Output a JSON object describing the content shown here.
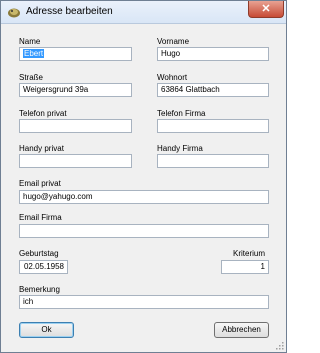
{
  "window": {
    "title": "Adresse bearbeiten",
    "close_symbol": "✕"
  },
  "form": {
    "name": {
      "label": "Name",
      "value": "Ebert"
    },
    "vorname": {
      "label": "Vorname",
      "value": "Hugo"
    },
    "strasse": {
      "label": "Straße",
      "value": "Weigersgrund 39a"
    },
    "wohnort": {
      "label": "Wohnort",
      "value": "63864 Glattbach"
    },
    "telefon_privat": {
      "label": "Telefon privat",
      "value": ""
    },
    "telefon_firma": {
      "label": "Telefon Firma",
      "value": ""
    },
    "handy_privat": {
      "label": "Handy privat",
      "value": ""
    },
    "handy_firma": {
      "label": "Handy Firma",
      "value": ""
    },
    "email_privat": {
      "label": "Email privat",
      "value": "hugo@yahugo.com"
    },
    "email_firma": {
      "label": "Email Firma",
      "value": ""
    },
    "geburtstag": {
      "label": "Geburtstag",
      "value": "02.05.1958"
    },
    "kriterium": {
      "label": "Kriterium",
      "value": "1"
    },
    "bemerkung": {
      "label": "Bemerkung",
      "value": "ich"
    }
  },
  "buttons": {
    "ok": "Ok",
    "cancel": "Abbrechen"
  },
  "colors": {
    "selection": "#3399ff",
    "window_bg": "#f0f0f0",
    "close_button": "#c74b35"
  }
}
